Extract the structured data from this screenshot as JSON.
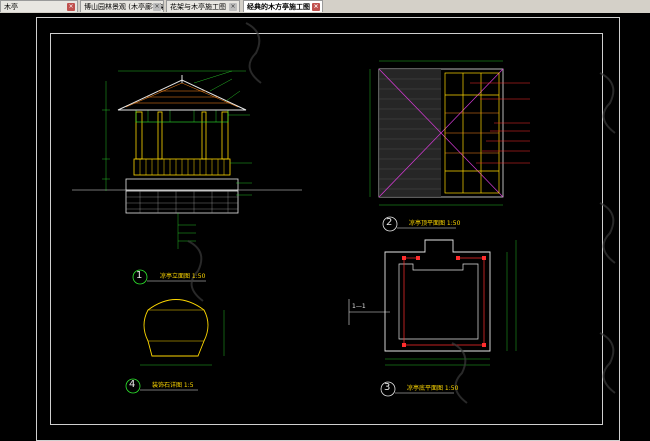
{
  "tabs": [
    {
      "label": "木亭",
      "active": false
    },
    {
      "label": "博山园林景观 (木亭廊花架",
      "active": false
    },
    {
      "label": "花架与木亭施工图",
      "active": false
    },
    {
      "label": "经典的木方亭施工图",
      "active": true
    }
  ],
  "close_glyph": "×",
  "drawing": {
    "views": [
      {
        "number": "1",
        "title": "凉亭立面图 1:50"
      },
      {
        "number": "2",
        "title": "凉亭顶平面图 1:50"
      },
      {
        "number": "3",
        "title": "凉亭底平面图 1:50"
      },
      {
        "number": "4",
        "title": "装饰石详图 1:5"
      }
    ],
    "section_marker": "1—1"
  },
  "colors": {
    "line_white": "#e6e6e6",
    "line_yellow": "#ffd900",
    "line_red": "#ff2d2d",
    "line_green": "#2ee82e",
    "line_cyan": "#2ad9e6",
    "line_magenta": "#d43ad4"
  }
}
